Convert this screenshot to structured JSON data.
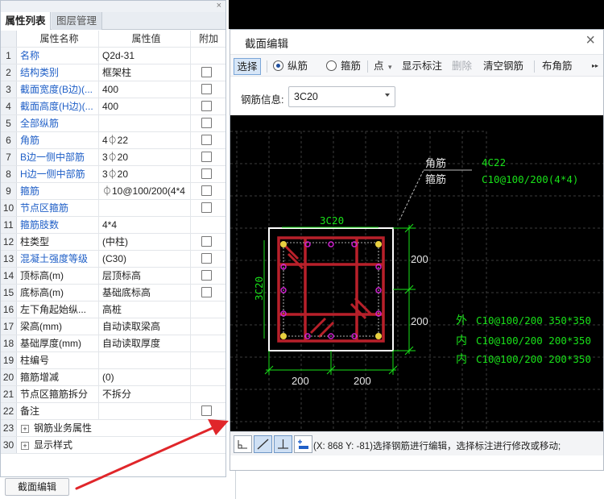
{
  "left_panel": {
    "close_glyph": "×",
    "tabs": [
      "属性列表",
      "图层管理"
    ],
    "headers": {
      "name": "属性名称",
      "value": "属性值",
      "add": "附加"
    },
    "rows": [
      {
        "num": "1",
        "name": "名称",
        "value": "Q2d-31",
        "blue": true,
        "checkbox": false
      },
      {
        "num": "2",
        "name": "结构类别",
        "value": "框架柱",
        "blue": true,
        "checkbox": true
      },
      {
        "num": "3",
        "name": "截面宽度(B边)(...",
        "value": "400",
        "blue": true,
        "checkbox": true
      },
      {
        "num": "4",
        "name": "截面高度(H边)(...",
        "value": "400",
        "blue": true,
        "checkbox": true
      },
      {
        "num": "5",
        "name": "全部纵筋",
        "value": "",
        "blue": true,
        "checkbox": true
      },
      {
        "num": "6",
        "name": "角筋",
        "value": "4⏀22",
        "blue": true,
        "checkbox": true
      },
      {
        "num": "7",
        "name": "B边一侧中部筋",
        "value": "3⏀20",
        "blue": true,
        "checkbox": true
      },
      {
        "num": "8",
        "name": "H边一侧中部筋",
        "value": "3⏀20",
        "blue": true,
        "checkbox": true
      },
      {
        "num": "9",
        "name": "箍筋",
        "value": "⏀10@100/200(4*4",
        "blue": true,
        "checkbox": true
      },
      {
        "num": "10",
        "name": "节点区箍筋",
        "value": "",
        "blue": true,
        "checkbox": true
      },
      {
        "num": "11",
        "name": "箍筋肢数",
        "value": "4*4",
        "blue": true,
        "checkbox": false
      },
      {
        "num": "12",
        "name": "柱类型",
        "value": "(中柱)",
        "blue": false,
        "checkbox": true
      },
      {
        "num": "13",
        "name": "混凝土强度等级",
        "value": "(C30)",
        "blue": true,
        "checkbox": true
      },
      {
        "num": "14",
        "name": "顶标高(m)",
        "value": "层顶标高",
        "blue": false,
        "checkbox": true
      },
      {
        "num": "15",
        "name": "底标高(m)",
        "value": "基础底标高",
        "blue": false,
        "checkbox": true
      },
      {
        "num": "16",
        "name": "左下角起始纵...",
        "value": "高桩",
        "blue": false,
        "checkbox": false
      },
      {
        "num": "17",
        "name": "梁高(mm)",
        "value": "自动读取梁高",
        "blue": false,
        "checkbox": false
      },
      {
        "num": "18",
        "name": "基础厚度(mm)",
        "value": "自动读取厚度",
        "blue": false,
        "checkbox": false
      },
      {
        "num": "19",
        "name": "柱编号",
        "value": "",
        "blue": false,
        "checkbox": false
      },
      {
        "num": "20",
        "name": "箍筋增减",
        "value": "(0)",
        "blue": false,
        "checkbox": false
      },
      {
        "num": "21",
        "name": "节点区箍筋拆分",
        "value": "不拆分",
        "blue": false,
        "checkbox": false
      },
      {
        "num": "22",
        "name": "备注",
        "value": "",
        "blue": false,
        "checkbox": true
      },
      {
        "num": "23",
        "name": "钢筋业务属性",
        "value": "",
        "blue": false,
        "checkbox": false,
        "expand": true
      },
      {
        "num": "30",
        "name": "显示样式",
        "value": "",
        "blue": false,
        "checkbox": false,
        "expand": true
      }
    ],
    "expand_glyph": "+",
    "section_button": "截面编辑"
  },
  "dialog": {
    "title": "截面编辑",
    "close_glyph": "×",
    "toolbar": {
      "select": "选择",
      "longitudinal": "纵筋",
      "stirrup": "箍筋",
      "point": "点",
      "dropdown_glyph": "▾",
      "show_labels": "显示标注",
      "delete": "删除",
      "clear": "清空钢筋",
      "corner": "布角筋",
      "more": "▸▸"
    },
    "info_label": "钢筋信息:",
    "info_value": "3C20",
    "canvas": {
      "corner_label": "角筋",
      "corner_value": "4C22",
      "stirrup_label": "箍筋",
      "stirrup_value": "C10@100/200(4*4)",
      "top_label": "3C20",
      "left_label": "3C20",
      "dim_right_top": "200",
      "dim_right_bottom": "200",
      "dim_bottom_left": "200",
      "dim_bottom_right": "200",
      "outer_label": "外",
      "outer_value": "C10@100/200 350*350",
      "inner1_label": "内",
      "inner1_value": "C10@100/200 200*350",
      "inner2_label": "内",
      "inner2_value": "C10@100/200 200*350"
    },
    "status_text": "(X: 868 Y: -81)选择钢筋进行编辑，选择标注进行修改或移动;"
  },
  "colors": {
    "rebar_red": "#b8202a",
    "dim_green": "#19e019",
    "corner_yellow": "#e8d040",
    "mid_magenta": "#d020d0",
    "link_blue": "#1f5fc7",
    "arrow_red": "#e0262a"
  }
}
